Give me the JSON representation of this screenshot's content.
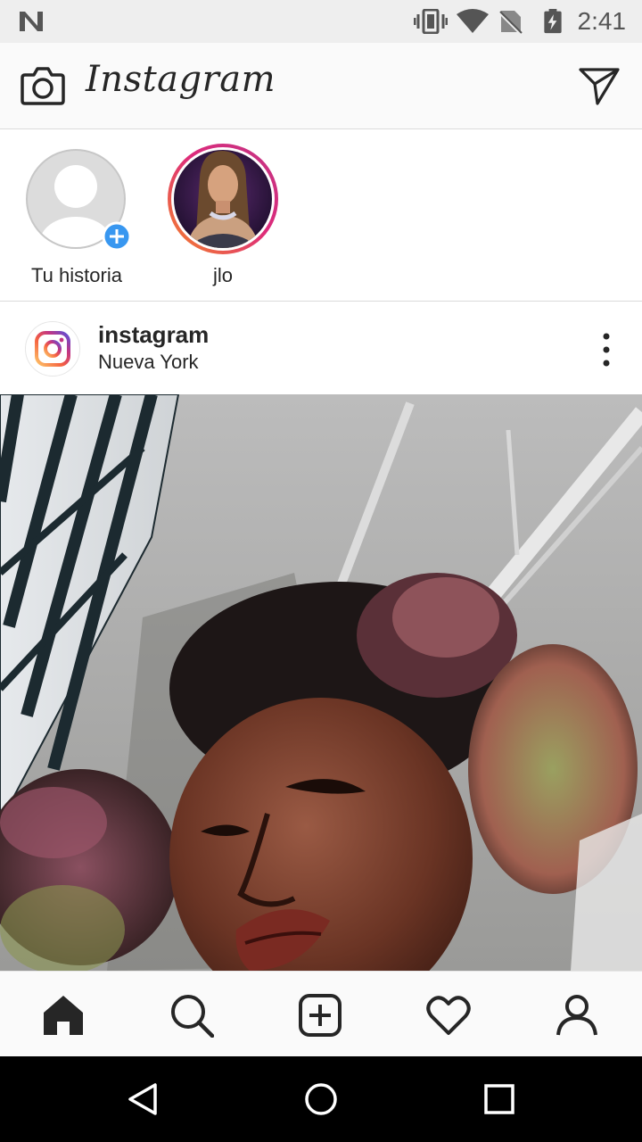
{
  "status_bar": {
    "time": "2:41",
    "icons": [
      "notification-n-icon",
      "vibrate-icon",
      "wifi-icon",
      "no-sim-icon",
      "battery-charging-icon"
    ]
  },
  "header": {
    "logo_text": "Instagram",
    "left_icon": "camera-icon",
    "right_icon": "direct-message-icon"
  },
  "stories": [
    {
      "label": "Tu historia",
      "has_add_badge": true
    },
    {
      "label": "jlo",
      "has_ring": true
    }
  ],
  "post": {
    "username": "instagram",
    "location": "Nueva York",
    "menu_icon": "more-options-icon"
  },
  "bottom_nav": [
    "home-icon",
    "search-icon",
    "new-post-icon",
    "activity-heart-icon",
    "profile-icon"
  ],
  "system_nav": [
    "back-icon",
    "home-circle-icon",
    "recents-icon"
  ],
  "colors": {
    "story_ring_start": "#f58529",
    "story_ring_mid": "#dd2a7b",
    "story_ring_end": "#8134af",
    "add_badge": "#3897f0",
    "text": "#262626"
  }
}
